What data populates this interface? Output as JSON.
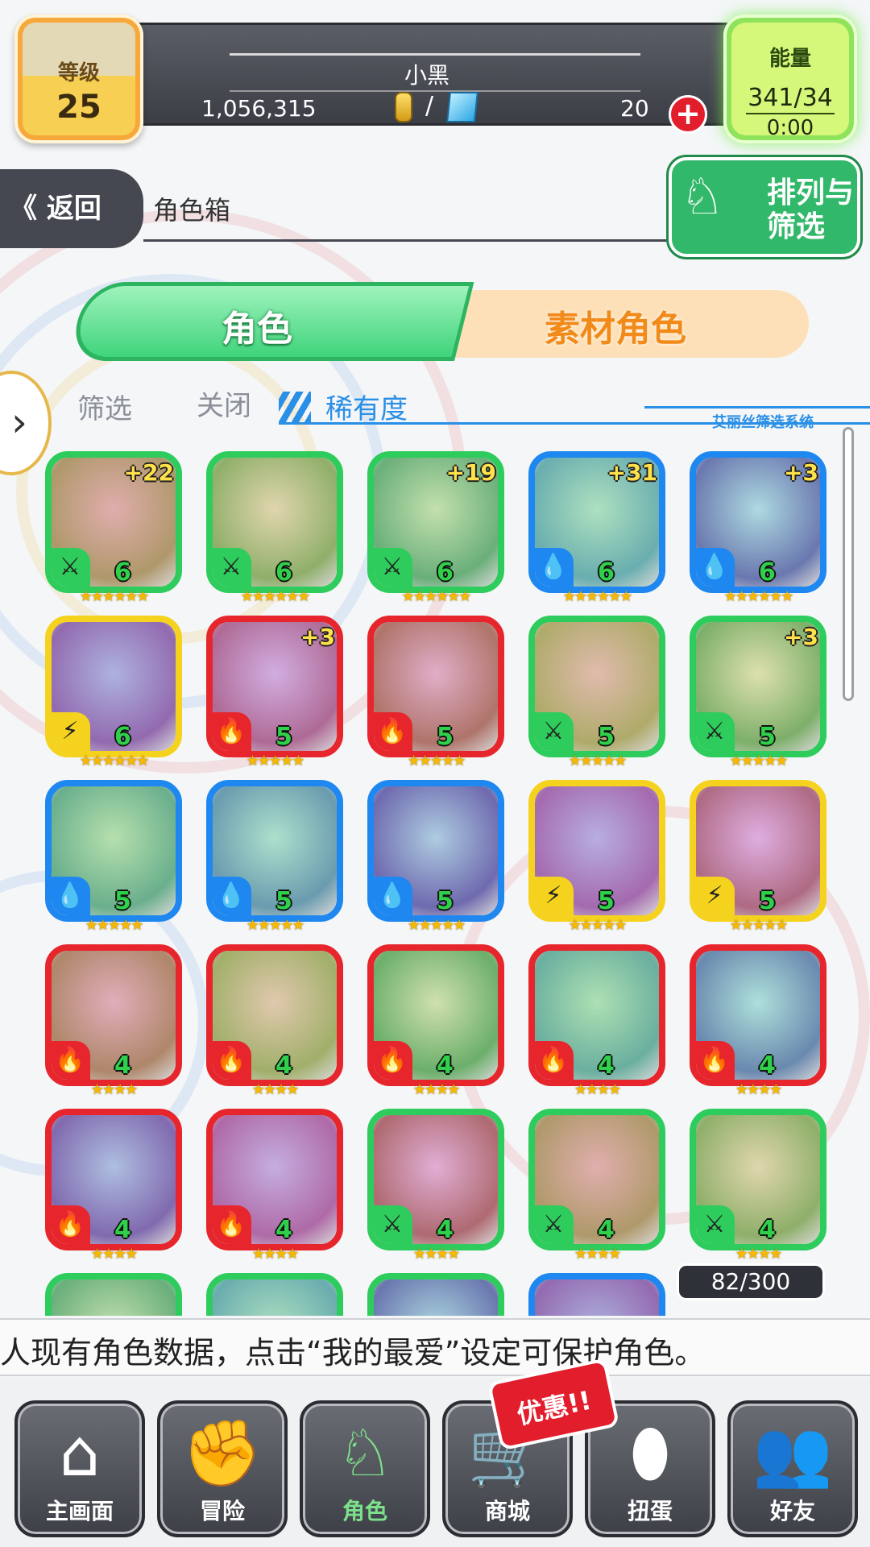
{
  "header": {
    "level_label": "等级",
    "level": "25",
    "player_name": "小黑",
    "gold": "1,056,315",
    "slash": "/",
    "gems": "20",
    "energy_label": "能量",
    "energy_value": "341/34",
    "energy_timer": "0:00"
  },
  "titlebar": {
    "back_label": "《 返回",
    "title": "角色箱",
    "sort_label": "排列与筛选"
  },
  "tabs": [
    {
      "label": "角色",
      "active": true
    },
    {
      "label": "素材角色",
      "active": false
    }
  ],
  "filter": {
    "filter_label": "筛选",
    "toggle_label": "关闭",
    "rarity_label": "稀有度",
    "system_label": "艾丽丝筛选系统"
  },
  "characters": [
    {
      "element": "wind",
      "color": "green",
      "level": "6",
      "plus": "+22",
      "stars": 6
    },
    {
      "element": "wind",
      "color": "green",
      "level": "6",
      "plus": "",
      "stars": 6
    },
    {
      "element": "wind",
      "color": "green",
      "level": "6",
      "plus": "+19",
      "stars": 6
    },
    {
      "element": "water",
      "color": "blue",
      "level": "6",
      "plus": "+31",
      "stars": 6
    },
    {
      "element": "water",
      "color": "blue",
      "level": "6",
      "plus": "+3",
      "stars": 6
    },
    {
      "element": "thunder",
      "color": "yellow",
      "level": "6",
      "plus": "",
      "stars": 6
    },
    {
      "element": "fire",
      "color": "red",
      "level": "5",
      "plus": "+3",
      "stars": 5
    },
    {
      "element": "fire",
      "color": "red",
      "level": "5",
      "plus": "",
      "stars": 5
    },
    {
      "element": "wind",
      "color": "green",
      "level": "5",
      "plus": "",
      "stars": 5
    },
    {
      "element": "wind",
      "color": "green",
      "level": "5",
      "plus": "+3",
      "stars": 5
    },
    {
      "element": "water",
      "color": "blue",
      "level": "5",
      "plus": "",
      "stars": 5
    },
    {
      "element": "water",
      "color": "blue",
      "level": "5",
      "plus": "",
      "stars": 5
    },
    {
      "element": "water",
      "color": "blue",
      "level": "5",
      "plus": "",
      "stars": 5
    },
    {
      "element": "thunder",
      "color": "yellow",
      "level": "5",
      "plus": "",
      "stars": 5
    },
    {
      "element": "thunder",
      "color": "yellow",
      "level": "5",
      "plus": "",
      "stars": 5
    },
    {
      "element": "fire",
      "color": "red",
      "level": "4",
      "plus": "",
      "stars": 4
    },
    {
      "element": "fire",
      "color": "red",
      "level": "4",
      "plus": "",
      "stars": 4
    },
    {
      "element": "fire",
      "color": "red",
      "level": "4",
      "plus": "",
      "stars": 4
    },
    {
      "element": "fire",
      "color": "red",
      "level": "4",
      "plus": "",
      "stars": 4
    },
    {
      "element": "fire",
      "color": "red",
      "level": "4",
      "plus": "",
      "stars": 4
    },
    {
      "element": "fire",
      "color": "red",
      "level": "4",
      "plus": "",
      "stars": 4
    },
    {
      "element": "fire",
      "color": "red",
      "level": "4",
      "plus": "",
      "stars": 4
    },
    {
      "element": "wind",
      "color": "green",
      "level": "4",
      "plus": "",
      "stars": 4
    },
    {
      "element": "wind",
      "color": "green",
      "level": "4",
      "plus": "",
      "stars": 4
    },
    {
      "element": "wind",
      "color": "green",
      "level": "4",
      "plus": "",
      "stars": 4
    },
    {
      "element": "wind",
      "color": "green",
      "level": "",
      "plus": "",
      "stars": 0
    },
    {
      "element": "wind",
      "color": "green",
      "level": "",
      "plus": "",
      "stars": 0
    },
    {
      "element": "wind",
      "color": "green",
      "level": "",
      "plus": "",
      "stars": 0
    },
    {
      "element": "water",
      "color": "blue",
      "level": "",
      "plus": "",
      "stars": 0
    }
  ],
  "capacity": "82/300",
  "ticker": "人现有角色数据，点击“我的最爱”设定可保护角色。",
  "promo": "优惠!!",
  "nav": [
    {
      "label": "主画面",
      "icon": "home-icon",
      "glyph": "⌂",
      "active": false
    },
    {
      "label": "冒险",
      "icon": "handshake-icon",
      "glyph": "✊",
      "active": false
    },
    {
      "label": "角色",
      "icon": "rabbit-icon",
      "glyph": "♘",
      "active": true
    },
    {
      "label": "商城",
      "icon": "cart-icon",
      "glyph": "🛒",
      "active": false
    },
    {
      "label": "扭蛋",
      "icon": "egg-icon",
      "glyph": "⬮",
      "active": false
    },
    {
      "label": "好友",
      "icon": "friends-icon",
      "glyph": "👥",
      "active": false
    }
  ],
  "element_glyphs": {
    "wind": "⚔",
    "water": "💧",
    "fire": "🔥",
    "thunder": "⚡"
  },
  "colors": {
    "wind": "#2ecc5c",
    "water": "#1e88f0",
    "fire": "#e6262c",
    "thunder": "#f5d21e"
  }
}
